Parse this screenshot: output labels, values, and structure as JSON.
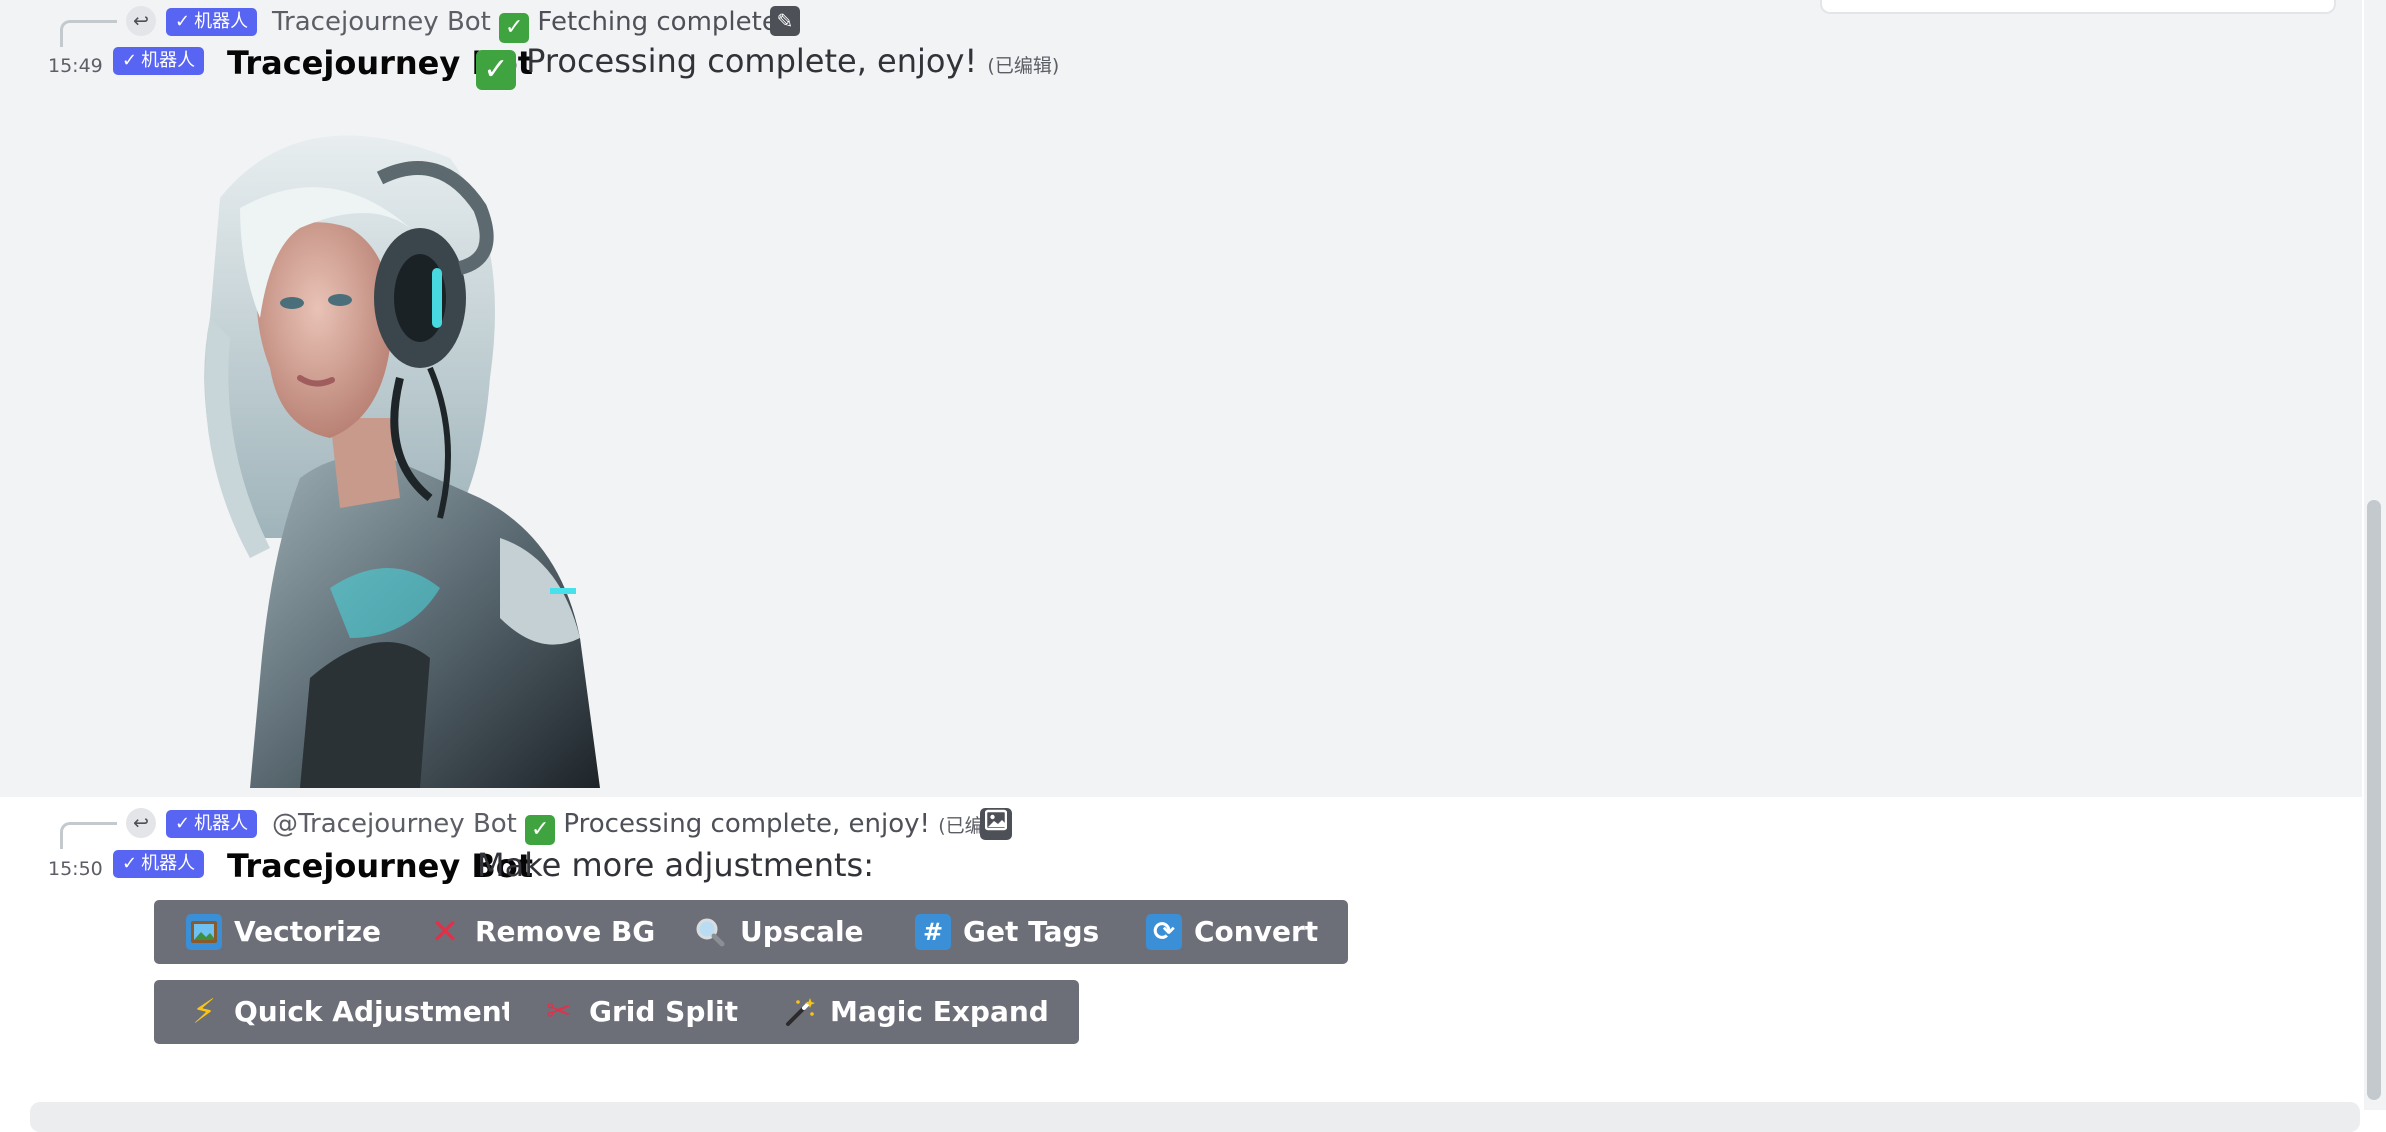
{
  "app": {
    "colors": {
      "accent": "#5865f2",
      "button_bg": "#6d6f78",
      "highlight_bg": "#f2f3f5",
      "check_green": "#3fa33f"
    }
  },
  "messages": [
    {
      "reply": {
        "icon": "reply-arrow-icon",
        "badge": "机器人",
        "author": "Tracejourney Bot",
        "text": "Fetching complete!",
        "trailing_icon": "pencil-icon"
      },
      "timestamp": "15:49",
      "badge": "机器人",
      "author": "Tracejourney Bot",
      "content": "Processing complete, enjoy!",
      "edited": "(已编辑)",
      "attachment": "generated-image"
    },
    {
      "reply": {
        "icon": "reply-arrow-icon",
        "badge": "机器人",
        "author": "@Tracejourney Bot",
        "text": "Processing complete, enjoy!",
        "edited": "(已编辑)",
        "trailing_icon": "image-icon"
      },
      "timestamp": "15:50",
      "badge": "机器人",
      "author": "Tracejourney Bot",
      "content": "Make more adjustments:",
      "buttons": [
        {
          "label": "Vectorize",
          "icon": "framed-picture-icon"
        },
        {
          "label": "Remove BG",
          "icon": "cross-mark-icon"
        },
        {
          "label": "Upscale",
          "icon": "magnifier-icon"
        },
        {
          "label": "Get Tags",
          "icon": "hashtag-icon"
        },
        {
          "label": "Convert",
          "icon": "refresh-icon"
        },
        {
          "label": "Quick Adjustments",
          "icon": "lightning-icon"
        },
        {
          "label": "Grid Split",
          "icon": "scissors-icon"
        },
        {
          "label": "Magic Expand",
          "icon": "magic-wand-icon"
        }
      ]
    }
  ]
}
